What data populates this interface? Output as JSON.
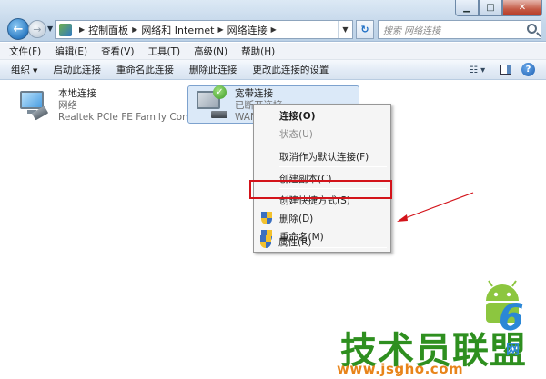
{
  "window": {
    "controls": {
      "minimize": "▁",
      "maximize": "□",
      "close": "✕"
    }
  },
  "address": {
    "crumbs": [
      "控制面板",
      "网络和 Internet",
      "网络连接"
    ],
    "search_placeholder": "搜索 网络连接"
  },
  "menubar": {
    "items": [
      "文件(F)",
      "编辑(E)",
      "查看(V)",
      "工具(T)",
      "高级(N)",
      "帮助(H)"
    ]
  },
  "commandbar": {
    "organize": "组织",
    "items": [
      "启动此连接",
      "重命名此连接",
      "删除此连接",
      "更改此连接的设置"
    ]
  },
  "connections": [
    {
      "name": "本地连接",
      "status": "网络",
      "device": "Realtek PCIe FE Family Control..."
    },
    {
      "name": "宽带连接",
      "status": "已断开连接",
      "device": "WAN M"
    }
  ],
  "context_menu": {
    "items": [
      {
        "label": "连接(O)",
        "bold": true
      },
      {
        "label": "状态(U)",
        "disabled": true
      },
      {
        "label": "取消作为默认连接(F)"
      },
      {
        "label": "创建副本(C)"
      },
      {
        "label": "创建快捷方式(S)"
      },
      {
        "label": "删除(D)",
        "icon": "shield-icon"
      },
      {
        "label": "重命名(M)",
        "icon": "shield-icon"
      },
      {
        "label": "属性(R)",
        "icon": "shield-icon"
      }
    ]
  },
  "watermark": {
    "brand": "技术员联盟",
    "url": "www.jsgho.com",
    "number": "6",
    "net": "网"
  },
  "colors": {
    "highlight": "#d3131a",
    "selection": "#dbe9f8"
  }
}
